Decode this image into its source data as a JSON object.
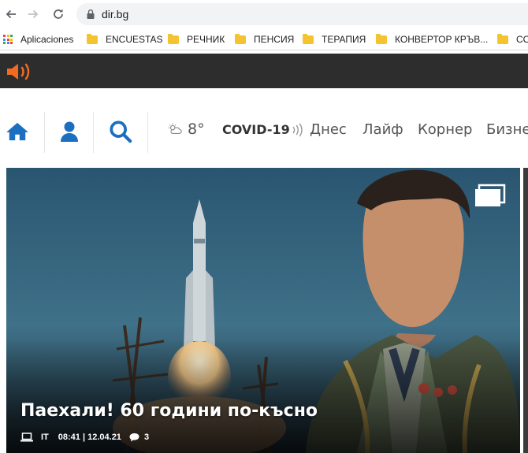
{
  "browser": {
    "url": "dir.bg",
    "bookmarks": [
      {
        "label": "Aplicaciones",
        "type": "apps"
      },
      {
        "label": "ENCUESTAS",
        "type": "folder"
      },
      {
        "label": "РЕЧНИК",
        "type": "folder"
      },
      {
        "label": "ПЕНСИЯ",
        "type": "folder"
      },
      {
        "label": "ТЕРАПИЯ",
        "type": "folder"
      },
      {
        "label": "КОНВЕРТОР КРЪВ...",
        "type": "folder"
      },
      {
        "label": "CO",
        "type": "folder"
      }
    ]
  },
  "site": {
    "weather": {
      "temp": "8°",
      "icon": "cloud-sun-icon"
    },
    "covid_label": "COVID-19",
    "menu": [
      {
        "label": "Днес"
      },
      {
        "label": "Лайф"
      },
      {
        "label": "Корнер"
      },
      {
        "label": "Бизнес"
      }
    ],
    "hero": {
      "title": "Паехали! 60 години по-късно",
      "category": "IT",
      "datetime": "08:41 | 12.04.21",
      "comments": "3"
    },
    "colors": {
      "accent_orange": "#f26b21",
      "nav_blue": "#1a6fc0",
      "topbar_dark": "#2d2d2d"
    }
  }
}
